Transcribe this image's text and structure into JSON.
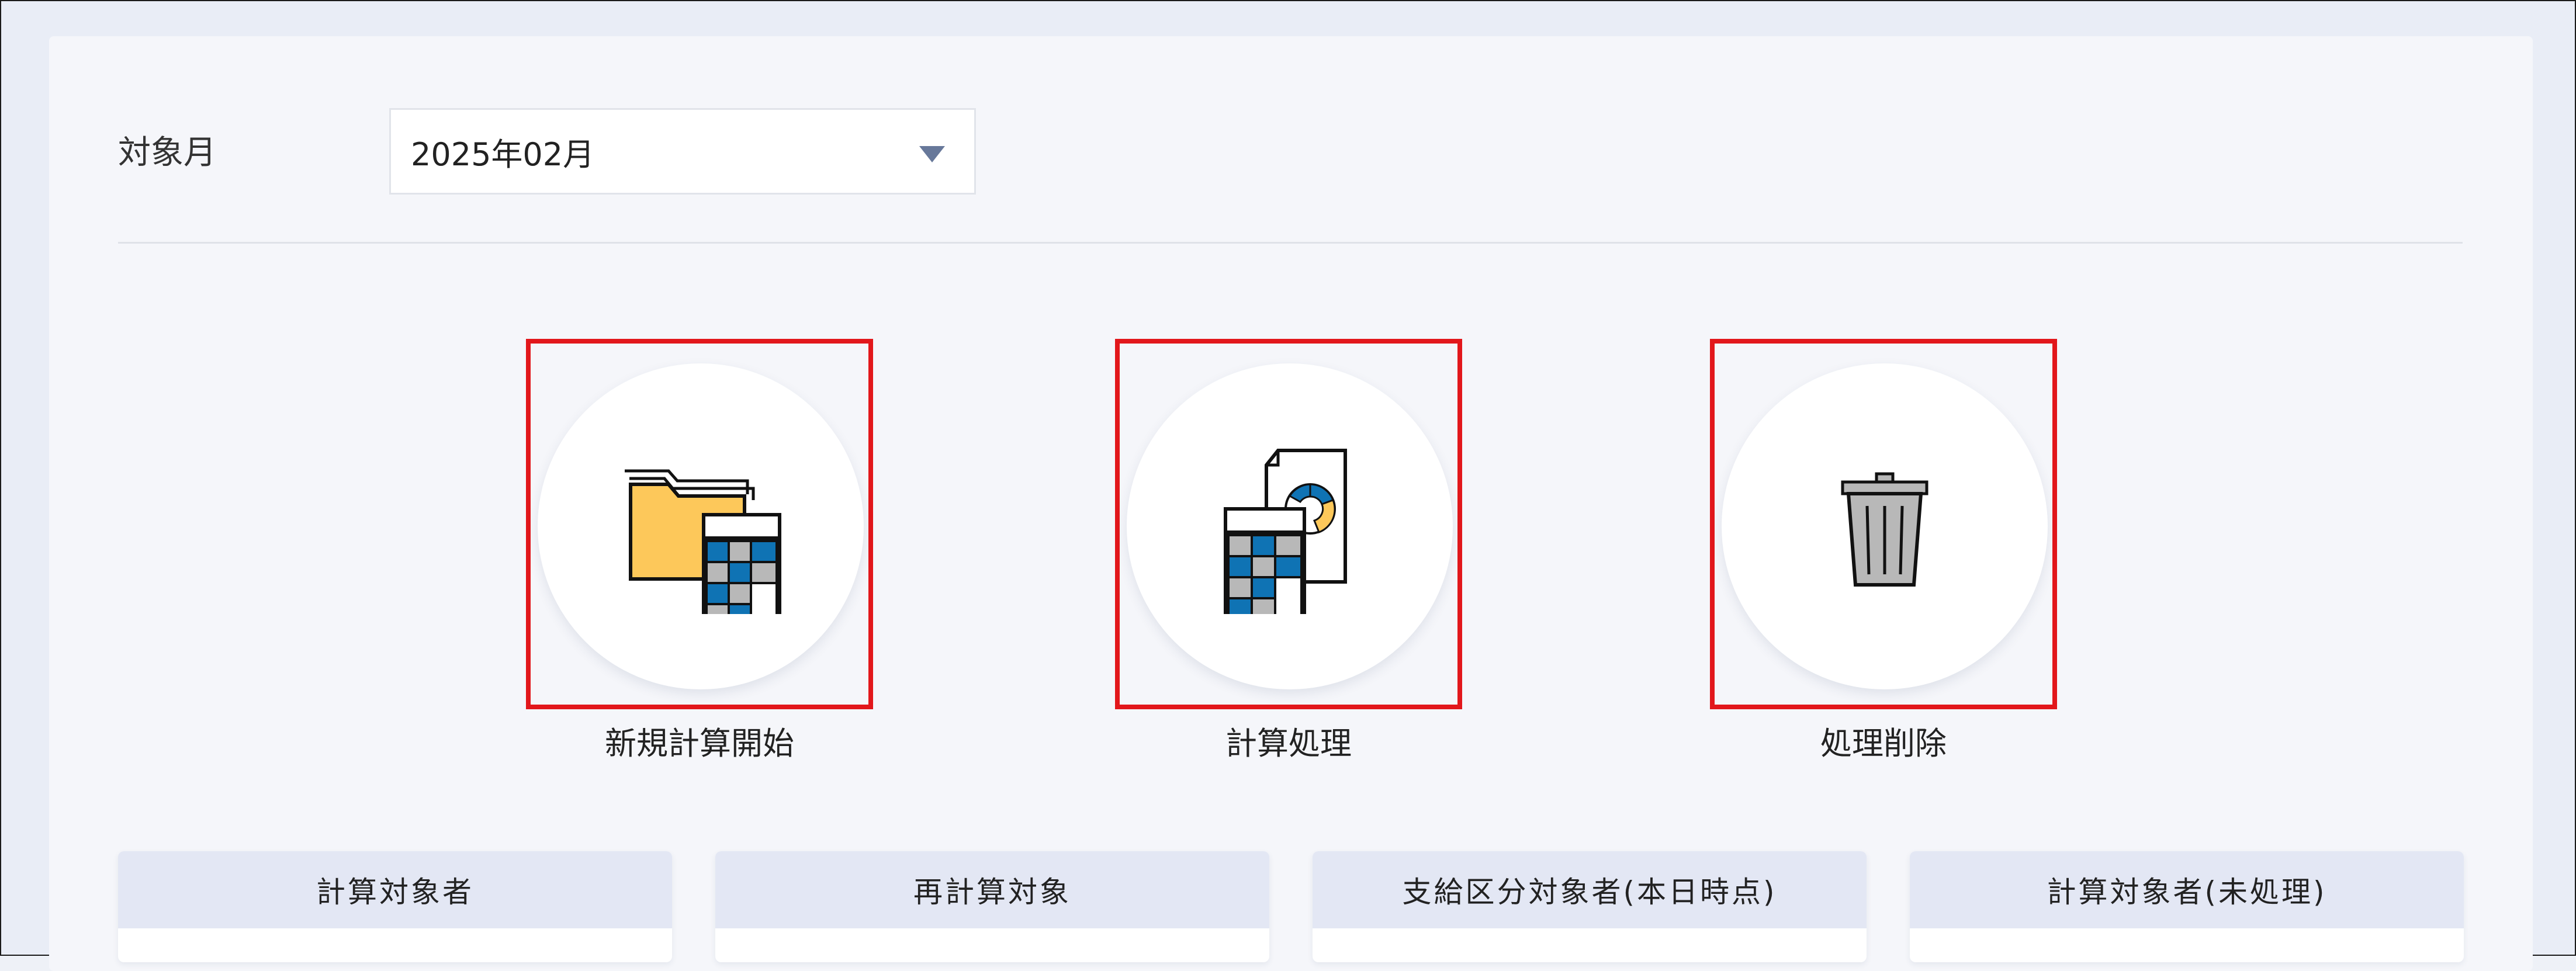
{
  "filter": {
    "label": "対象月",
    "selected_month": "2025年02月"
  },
  "actions": [
    {
      "label": "新規計算開始",
      "icon": "folder-calculator-icon"
    },
    {
      "label": "計算処理",
      "icon": "calculator-report-icon"
    },
    {
      "label": "処理削除",
      "icon": "trash-can-icon"
    }
  ],
  "summary_cards": [
    {
      "title": "計算対象者"
    },
    {
      "title": "再計算対象"
    },
    {
      "title": "支給区分対象者(本日時点)"
    },
    {
      "title": "計算対象者(未処理)"
    }
  ],
  "colors": {
    "highlight_border": "#e2171b",
    "card_header": "#e3e7f4",
    "folder_yellow": "#fdc85a",
    "calc_blue": "#0f73b4",
    "calc_gray": "#b8b8b8"
  }
}
